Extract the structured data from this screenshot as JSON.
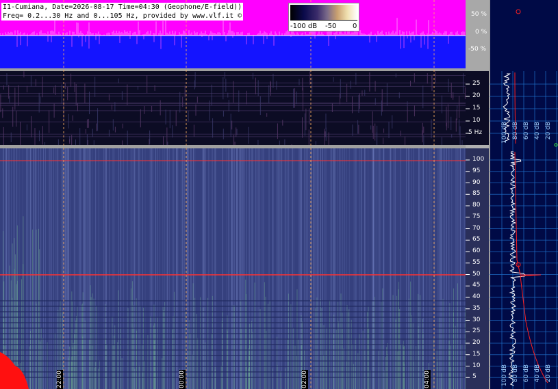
{
  "header": {
    "line1": "I1-Cumiana, Date=2026-08-17 Time=04:30 (Geophone/E-field))",
    "line2": "Freq= 0.2...30 Hz and 0...105 Hz, provided by www.vlf.it ©"
  },
  "colorbar": {
    "labels": [
      "-100 dB",
      "-50",
      "0"
    ]
  },
  "amplitude_axis": {
    "labels": [
      "50 %",
      "0 %",
      "-50 %"
    ]
  },
  "low_freq_axis": {
    "labels": [
      "25",
      "20",
      "15",
      "10",
      "5 Hz"
    ]
  },
  "high_freq_axis": {
    "labels": [
      "100",
      "95",
      "90",
      "85",
      "80",
      "75",
      "70",
      "65",
      "60",
      "55",
      "50",
      "45",
      "40",
      "35",
      "30",
      "25",
      "20",
      "15",
      "10",
      "5"
    ]
  },
  "time_axis": {
    "labels": [
      "22:00",
      "00:00",
      "02:00",
      "04:00"
    ]
  },
  "spectrum_axis_top": {
    "labels": [
      "100 dB",
      "80 dB",
      "60 dB",
      "40 dB",
      "20 dB"
    ]
  },
  "spectrum_axis_bottom": {
    "labels": [
      "100 dB",
      "80 dB",
      "60 dB",
      "40 dB",
      "20 dB"
    ]
  },
  "colors": {
    "magenta": "#ff00ff",
    "blue": "#1414ff",
    "dark_navy": "#000040",
    "gray": "#a0a0a0",
    "grid_orange": "#ffb060",
    "red_line": "#ff3030",
    "spectrum_white": "#ffffff",
    "spectrum_red": "#ff2020",
    "axis_grid": "#1e6ec8"
  }
}
